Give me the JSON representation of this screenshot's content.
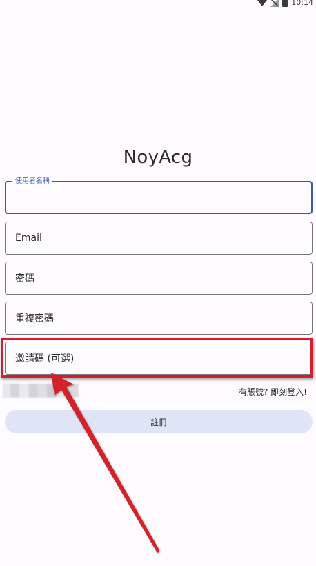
{
  "status_bar": {
    "time": "10:14",
    "icons": [
      "wifi-icon",
      "signal-icon",
      "battery-icon"
    ]
  },
  "app": {
    "title": "NoyAcg"
  },
  "form": {
    "username": {
      "label": "使用者名稱",
      "value": ""
    },
    "email": {
      "placeholder": "Email"
    },
    "password": {
      "placeholder": "密碼"
    },
    "confirm_password": {
      "placeholder": "重複密碼"
    },
    "invite_code": {
      "placeholder": "邀請碼 (可選)"
    },
    "login_link": "有賬號? 即刻登入!",
    "submit_label": "註冊"
  },
  "colors": {
    "background": "#fdfbff",
    "focus": "#3b5aa3",
    "button": "#dfe4f7",
    "annotation": "#d2202a"
  }
}
